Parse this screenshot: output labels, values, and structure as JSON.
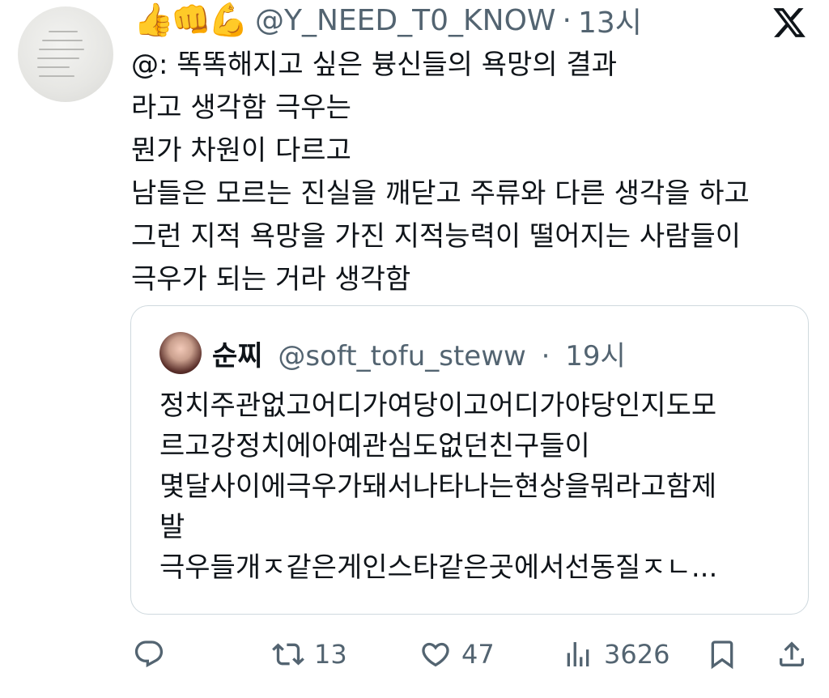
{
  "tweet": {
    "emojis": [
      "👍",
      "👊",
      "💪"
    ],
    "handle": "@Y_NEED_T0_KNOW",
    "separator": "·",
    "time": "13시",
    "text": "@: 똑똑해지고 싶은 븅신들의 욕망의 결과\n라고 생각함 극우는\n뭔가 차원이 다르고\n남들은 모르는 진실을 깨닫고 주류와 다른 생각을 하고\n그런 지적 욕망을 가진 지적능력이 떨어지는 사람들이\n극우가 되는 거라 생각함"
  },
  "quote": {
    "name": "순찌",
    "handle": "@soft_tofu_steww",
    "separator": "·",
    "time": "19시",
    "text": "정치주관없고어디가여당이고어디가야당인지도모\n르고강정치에아예관심도없던친구들이\n몇달사이에극우가돼서나타나는현상을뭐라고함제\n발\n극우들개ㅈ같은게인스타같은곳에서선동질ㅈㄴ..."
  },
  "actions": {
    "reply_icon": "reply-icon",
    "retweet_icon": "retweet-icon",
    "retweets": "13",
    "like_icon": "heart-icon",
    "likes": "47",
    "views_icon": "views-icon",
    "views": "3626",
    "bookmark_icon": "bookmark-icon",
    "share_icon": "share-icon"
  },
  "colors": {
    "text": "#0f1419",
    "muted": "#536471",
    "border": "#cfd9de"
  }
}
